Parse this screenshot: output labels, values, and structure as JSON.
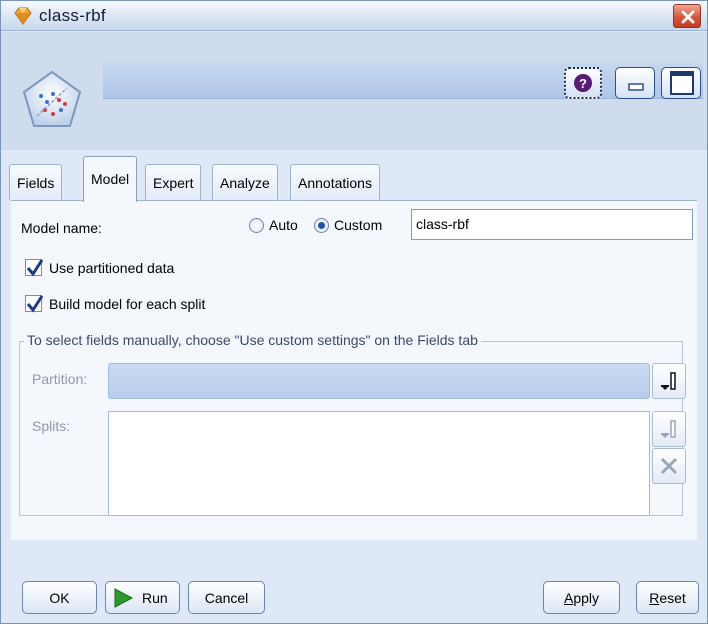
{
  "window": {
    "title": "class-rbf"
  },
  "tabs": [
    {
      "label": "Fields"
    },
    {
      "label": "Model"
    },
    {
      "label": "Expert"
    },
    {
      "label": "Analyze"
    },
    {
      "label": "Annotations"
    }
  ],
  "active_tab": "Model",
  "model_name": {
    "label": "Model name:",
    "option_auto": "Auto",
    "option_custom": "Custom",
    "selected": "Custom",
    "value": "class-rbf"
  },
  "options": {
    "use_partitioned_label": "Use partitioned data",
    "use_partitioned_checked": true,
    "build_each_split_label": "Build model for each split",
    "build_each_split_checked": true
  },
  "fields_group": {
    "legend": "To select fields manually, choose \"Use custom settings\" on the Fields tab",
    "partition_label": "Partition:",
    "partition_value": "",
    "splits_label": "Splits:"
  },
  "buttons": {
    "ok": "OK",
    "run": "Run",
    "cancel": "Cancel",
    "apply_prefix": "",
    "apply_ul": "A",
    "apply_rest": "pply",
    "reset_prefix": "",
    "reset_ul": "R",
    "reset_rest": "eset"
  },
  "colors": {
    "run_icon": "#2e9a2e",
    "close_button": "#d9553a",
    "help_icon": "#5a1a7a"
  }
}
